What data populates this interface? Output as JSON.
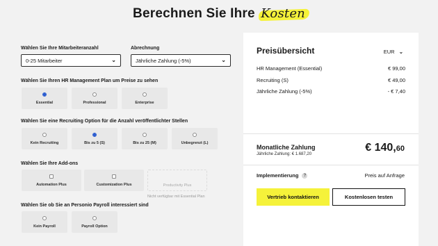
{
  "heading": {
    "text": "Berechnen Sie Ihre",
    "highlight": "Kosten"
  },
  "form": {
    "employees": {
      "label": "Wählen Sie Ihre Mitarbeiteranzahl",
      "value": "0-25 Mitarbeiter"
    },
    "billing": {
      "label": "Abrechnung",
      "value": "Jährliche Zahlung (-5%)"
    },
    "hr_plan": {
      "label": "Wählen Sie Ihren HR Management Plan um Preise zu sehen",
      "options": [
        "Essential",
        "Professional",
        "Enterprise"
      ],
      "selected": "Essential"
    },
    "recruiting": {
      "label": "Wählen Sie eine Recruiting Option für die Anzahl veröffentlichter Stellen",
      "options": [
        "Kein Recruiting",
        "Bis zu 5 (S)",
        "Bis zu 25 (M)",
        "Unbegrenzt (L)"
      ],
      "selected": "Bis zu 5 (S)"
    },
    "addons": {
      "label": "Wählen Sie Ihre Add-ons",
      "options": [
        "Automation Plus",
        "Customization Plus",
        "Productivity Plus"
      ],
      "unavailable_note": "Nicht verfügbar mit Essential Plan"
    },
    "payroll": {
      "label": "Wählen Sie ob Sie an Personio Payroll interessiert sind",
      "options": [
        "Kein Payroll",
        "Payroll Option"
      ]
    }
  },
  "summary": {
    "title": "Preisübersicht",
    "currency": "EUR",
    "lines": [
      {
        "label": "HR Management (Essential)",
        "value": "€ 99,00"
      },
      {
        "label": "Recruiting (S)",
        "value": "€ 49,00"
      },
      {
        "label": "Jährliche Zahlung (-5%)",
        "value": "- € 7,40"
      }
    ],
    "monthly_label": "Monatliche Zahlung",
    "yearly_label": "Jährliche Zahlung: € 1.687,20",
    "price_main": "€ 140,",
    "price_cents": "60",
    "implementation_label": "Implementierung",
    "implementation_help": "?",
    "implementation_value": "Preis auf Anfrage",
    "cta_contact": "Vertrieb kontaktieren",
    "cta_trial": "Kostenlosen testen"
  },
  "colors": {
    "accent": "#f5f23a",
    "radio_selected": "#2f5fd0",
    "background": "#f2f2f2"
  }
}
